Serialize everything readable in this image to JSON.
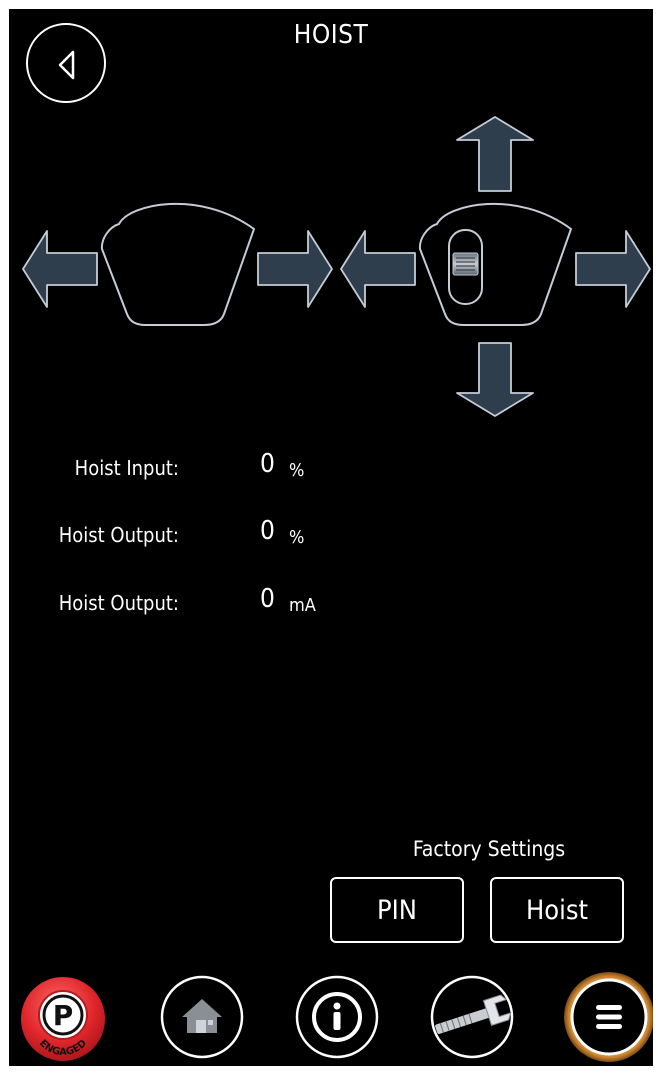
{
  "title": "HOIST",
  "readouts": [
    {
      "label": "Hoist Input:",
      "value": "0",
      "unit": "%"
    },
    {
      "label": "Hoist Output:",
      "value": "0",
      "unit": "%"
    },
    {
      "label": "Hoist Output:",
      "value": "0",
      "unit": "mA"
    }
  ],
  "factory_settings": {
    "title": "Factory Settings",
    "pin_label": "PIN",
    "hoist_label": "Hoist"
  },
  "bottom_nav": {
    "parking": {
      "letter": "P",
      "status": "ENGAGED",
      "color": "#e0262b"
    },
    "home_icon": "home-icon",
    "info_icon": "info-icon",
    "tools_icon": "wrench-icon",
    "menu_icon": "menu-icon",
    "menu_ring_color": "#c9822f"
  },
  "colors": {
    "background": "#000000",
    "arrow_fill": "#2f3e4c",
    "outline": "#c5ccd6"
  }
}
